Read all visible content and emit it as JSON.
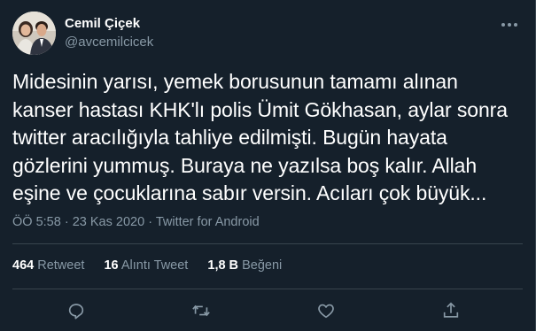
{
  "author": {
    "name": "Cemil Çiçek",
    "handle": "@avcemilcicek"
  },
  "tweet": {
    "text": "Midesinin yarısı, yemek borusunun tamamı alınan kanser hastası KHK'lı polis Ümit Gökhasan, aylar sonra twitter aracılığıyla tahliye edilmişti. Bugün hayata gözlerini yummuş. Buraya ne yazılsa boş kalır. Allah eşine ve çocuklarına sabır versin. Acıları çok büyük...",
    "time": "ÖÖ 5:58",
    "date": "23 Kas 2020",
    "source": "Twitter for Android",
    "separator": "·"
  },
  "stats": {
    "retweets_count": "464",
    "retweets_label": "Retweet",
    "quotes_count": "16",
    "quotes_label": "Alıntı Tweet",
    "likes_count": "1,8 B",
    "likes_label": "Beğeni"
  },
  "icons": {
    "more": "more-icon",
    "reply": "reply-icon",
    "retweet": "retweet-icon",
    "like": "like-icon",
    "share": "share-icon"
  },
  "colors": {
    "background": "#15202b",
    "secondary_text": "#8899a6",
    "divider": "#38444d"
  }
}
